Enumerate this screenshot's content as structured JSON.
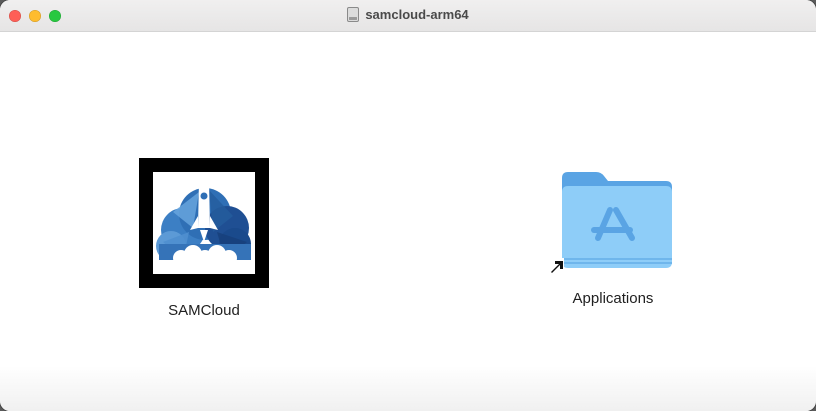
{
  "window": {
    "title": "samcloud-arm64",
    "title_icon": "disk-image-icon"
  },
  "items": [
    {
      "label": "SAMCloud",
      "icon": "samcloud-app-icon"
    },
    {
      "label": "Applications",
      "icon": "applications-folder-alias-icon"
    }
  ],
  "colors": {
    "close": "#fe5f57",
    "minimize": "#febc2e",
    "maximize": "#28c840",
    "folder_blue": "#7cc3f4",
    "cloud_blue": "#2f6fb5"
  }
}
